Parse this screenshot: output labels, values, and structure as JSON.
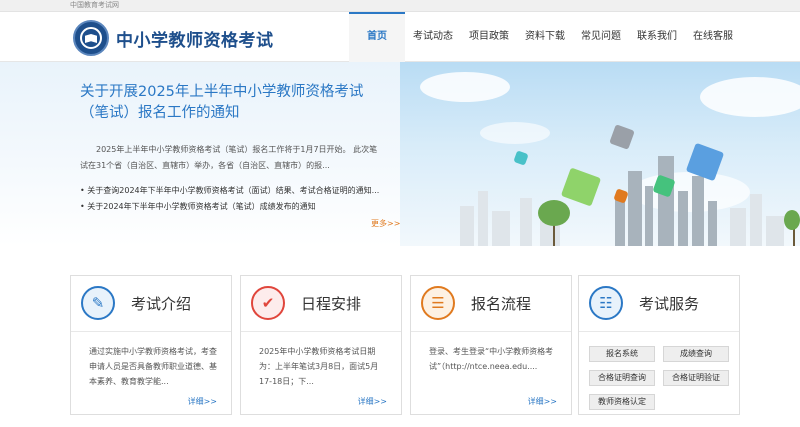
{
  "topbar": {
    "text": "中国教育考试网"
  },
  "header": {
    "site_title": "中小学教师资格考试",
    "nav": [
      {
        "label": "首页",
        "active": true
      },
      {
        "label": "考试动态",
        "active": false
      },
      {
        "label": "项目政策",
        "active": false
      },
      {
        "label": "资料下载",
        "active": false
      },
      {
        "label": "常见问题",
        "active": false
      },
      {
        "label": "联系我们",
        "active": false
      },
      {
        "label": "在线客服",
        "active": false
      }
    ]
  },
  "banner": {
    "title": "关于开展2025年上半年中小学教师资格考试（笔试）报名工作的通知",
    "desc": "2025年上半年中小学教师资格考试（笔试）报名工作将于1月7日开始。 此次笔试在31个省（自治区、直辖市）举办，各省（自治区、直辖市）的报...",
    "news": [
      "关于查询2024年下半年中小学教师资格考试（面试）结果、考试合格证明的通知...",
      "关于2024年下半年中小学教师资格考试（笔试）成绩发布的通知"
    ],
    "more": "更多>>"
  },
  "cards": [
    {
      "title": "考试介绍",
      "icon": "pencil-document-icon",
      "body": "通过实施中小学教师资格考试，考查申请人员是否具备教师职业道德、基本素养、教育教学能...",
      "link": "详细>>"
    },
    {
      "title": "日程安排",
      "icon": "checkmark-icon",
      "body": "2025年中小学教师资格考试日期为：上半年笔试3月8日，面试5月17-18日；下...",
      "link": "详细>>"
    },
    {
      "title": "报名流程",
      "icon": "form-icon",
      "body": "登录、考生登录“中小学教师资格考试”（http://ntce.neea.edu....",
      "link": "详细>>"
    },
    {
      "title": "考试服务",
      "icon": "id-card-icon",
      "buttons": [
        "报名系统",
        "成绩查询",
        "合格证明查询",
        "合格证明验证",
        "教师资格认定"
      ]
    }
  ],
  "colors": {
    "primary": "#2b78c5",
    "brand_dark": "#1e4f8c",
    "accent": "#e07a1f"
  }
}
